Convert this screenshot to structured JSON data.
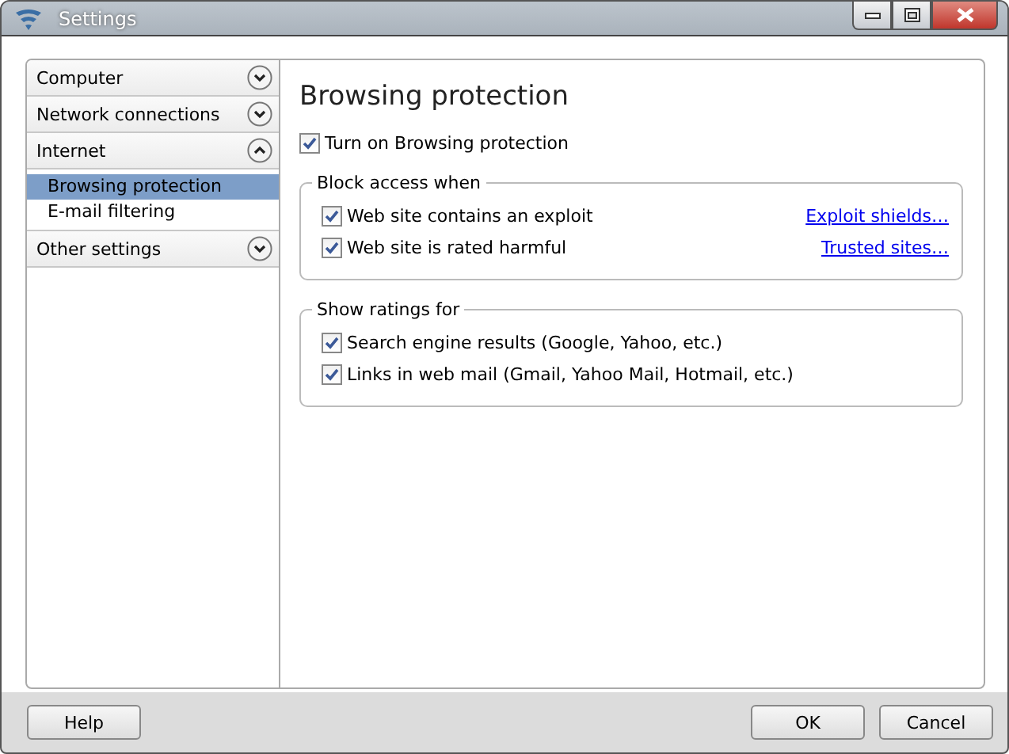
{
  "window": {
    "title": "Settings"
  },
  "sidebar": {
    "sections": [
      {
        "label": "Computer",
        "expanded": false
      },
      {
        "label": "Network connections",
        "expanded": false
      },
      {
        "label": "Internet",
        "expanded": true,
        "items": [
          {
            "label": "Browsing protection",
            "selected": true
          },
          {
            "label": "E-mail filtering",
            "selected": false
          }
        ]
      },
      {
        "label": "Other settings",
        "expanded": false
      }
    ]
  },
  "page": {
    "title": "Browsing protection",
    "main_toggle": {
      "label": "Turn on Browsing protection",
      "checked": true
    },
    "groups": [
      {
        "title": "Block access when",
        "options": [
          {
            "label": "Web site contains an exploit",
            "checked": true,
            "link": "Exploit shields…"
          },
          {
            "label": "Web site is rated harmful",
            "checked": true,
            "link": "Trusted sites…"
          }
        ]
      },
      {
        "title": "Show ratings for",
        "options": [
          {
            "label": "Search engine results (Google, Yahoo, etc.)",
            "checked": true
          },
          {
            "label": "Links in web mail (Gmail, Yahoo Mail, Hotmail, etc.)",
            "checked": true
          }
        ]
      }
    ]
  },
  "footer": {
    "left_buttons": [
      "Help"
    ],
    "right_buttons": [
      "OK",
      "Cancel"
    ]
  }
}
